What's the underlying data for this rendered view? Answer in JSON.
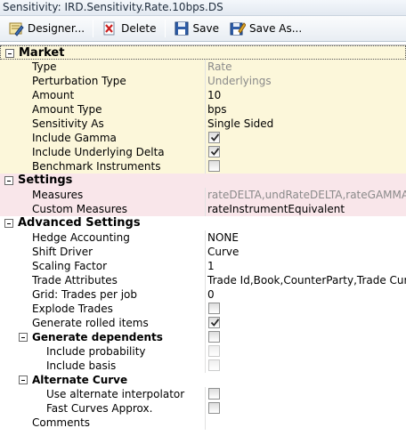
{
  "window": {
    "title": "Sensitivity: IRD.Sensitivity.Rate.10bps.DS"
  },
  "toolbar": {
    "designer_label": "Designer...",
    "delete_label": "Delete",
    "save_label": "Save",
    "save_as_label": "Save As..."
  },
  "market": {
    "heading": "Market",
    "type": {
      "label": "Type",
      "value": "Rate"
    },
    "perturbation_type": {
      "label": "Perturbation Type",
      "value": "Underlyings"
    },
    "amount": {
      "label": "Amount",
      "value": "10"
    },
    "amount_type": {
      "label": "Amount Type",
      "value": "bps"
    },
    "sensitivity_as": {
      "label": "Sensitivity As",
      "value": "Single Sided"
    },
    "include_gamma": {
      "label": "Include Gamma",
      "checked": true
    },
    "include_underlying_delta": {
      "label": "Include Underlying Delta",
      "checked": true
    },
    "benchmark_instruments": {
      "label": "Benchmark Instruments",
      "checked": false
    }
  },
  "settings": {
    "heading": "Settings",
    "measures": {
      "label": "Measures",
      "value": "rateDELTA,undRateDELTA,rateGAMMA"
    },
    "custom_measures": {
      "label": "Custom Measures",
      "value": "rateInstrumentEquivalent"
    }
  },
  "advanced": {
    "heading": "Advanced Settings",
    "hedge_accounting": {
      "label": "Hedge Accounting",
      "value": "NONE"
    },
    "shift_driver": {
      "label": "Shift Driver",
      "value": "Curve"
    },
    "scaling_factor": {
      "label": "Scaling Factor",
      "value": "1"
    },
    "trade_attributes": {
      "label": "Trade Attributes",
      "value": "Trade Id,Book,CounterParty,Trade Curr"
    },
    "grid_trades_per_job": {
      "label": "Grid: Trades per job",
      "value": "0"
    },
    "explode_trades": {
      "label": "Explode Trades",
      "checked": false
    },
    "generate_rolled_items": {
      "label": "Generate rolled items",
      "checked": true
    },
    "generate_dependents": {
      "label": "Generate dependents",
      "checked": false,
      "include_probability": {
        "label": "Include probability",
        "checked": false
      },
      "include_basis": {
        "label": "Include basis",
        "checked": false
      }
    },
    "alternate_curve": {
      "label": "Alternate Curve",
      "use_alternate_interpolator": {
        "label": "Use alternate interpolator",
        "checked": false
      },
      "fast_curves_approx": {
        "label": "Fast Curves Approx.",
        "checked": false
      }
    },
    "comments": {
      "label": "Comments",
      "value": ""
    }
  },
  "icons": {
    "designer": "designer-icon",
    "delete": "delete-icon",
    "save": "floppy-disk-icon",
    "save_as": "save-as-icon",
    "checkmark": "checkmark-icon"
  }
}
